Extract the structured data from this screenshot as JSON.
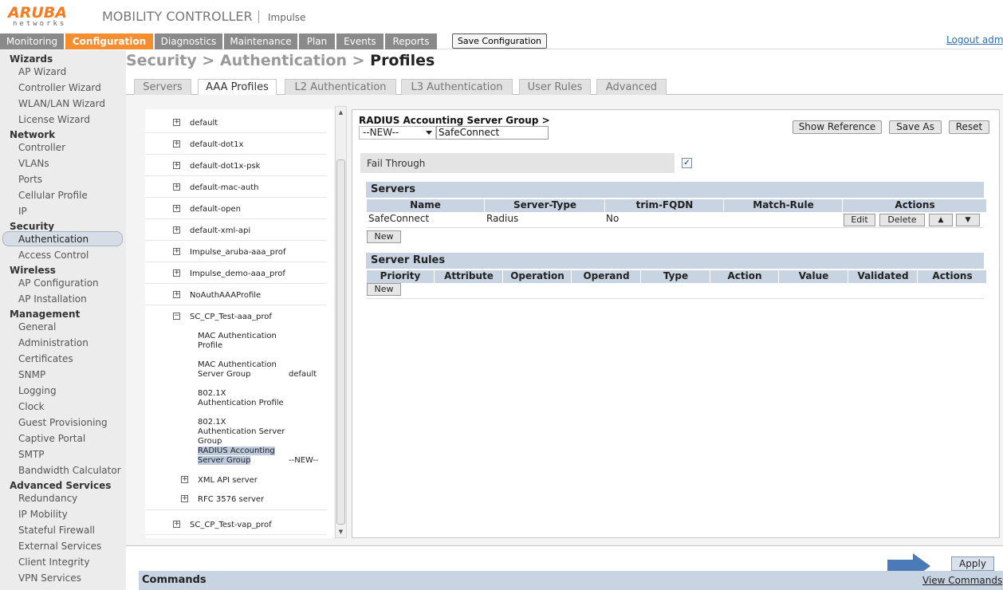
{
  "brand": {
    "logo_main": "ARUBA",
    "logo_sub": "networks",
    "product": "MOBILITY CONTROLLER",
    "controller": "Impulse",
    "accent": "#f68d2e"
  },
  "nav": {
    "tabs": [
      "Monitoring",
      "Configuration",
      "Diagnostics",
      "Maintenance",
      "Plan",
      "Events",
      "Reports"
    ],
    "save_config": "Save Configuration",
    "logout": "Logout admi"
  },
  "sidebar": {
    "wizards": "Wizards",
    "wizard_items": [
      "AP Wizard",
      "Controller Wizard",
      "WLAN/LAN Wizard",
      "License Wizard"
    ],
    "network": "Network",
    "network_items": [
      "Controller",
      "VLANs",
      "Ports",
      "Cellular Profile",
      "IP"
    ],
    "security": "Security",
    "security_items": [
      "Authentication",
      "Access Control"
    ],
    "wireless": "Wireless",
    "wireless_items": [
      "AP Configuration",
      "AP Installation"
    ],
    "management": "Management",
    "management_items": [
      "General",
      "Administration",
      "Certificates",
      "SNMP",
      "Logging",
      "Clock",
      "Guest Provisioning",
      "Captive Portal",
      "SMTP",
      "Bandwidth Calculator"
    ],
    "advanced": "Advanced Services",
    "advanced_items": [
      "Redundancy",
      "IP Mobility",
      "Stateful Firewall",
      "External Services",
      "Client Integrity",
      "VPN Services"
    ]
  },
  "page": {
    "crumb1": "Security",
    "sep": " > ",
    "crumb2": "Authentication",
    "current": "Profiles"
  },
  "subtabs": [
    "Servers",
    "AAA Profiles",
    "L2 Authentication",
    "L3 Authentication",
    "User Rules",
    "Advanced"
  ],
  "tree": {
    "profiles": [
      "default",
      "default-dot1x",
      "default-dot1x-psk",
      "default-mac-auth",
      "default-open",
      "default-xml-api",
      "Impulse_aruba-aaa_prof",
      "Impulse_demo-aaa_prof",
      "NoAuthAAAProfile",
      "SC_CP_Test-aaa_prof"
    ],
    "expanded_children": [
      {
        "label": "MAC Authentication Profile",
        "value": ""
      },
      {
        "label": "MAC Authentication Server Group",
        "value": "default"
      },
      {
        "label": "802.1X Authentication Profile",
        "value": ""
      },
      {
        "label": "802.1X Authentication Server Group",
        "value": ""
      },
      {
        "label": "RADIUS Accounting Server Group",
        "value": "--NEW--"
      }
    ],
    "sub_nodes": [
      "XML API server",
      "RFC 3576 server"
    ],
    "last_profile": "SC_CP_Test-vap_prof",
    "plus": "+",
    "minus": "−"
  },
  "detail": {
    "crumb": "RADIUS Accounting Server Group >",
    "select_value": "--NEW--",
    "name_value": "SafeConnect",
    "show_reference": "Show Reference",
    "save_as": "Save As",
    "reset": "Reset",
    "fail_through": "Fail Through",
    "fail_through_checked": "✓",
    "servers_title": "Servers",
    "servers_headers": [
      "Name",
      "Server-Type",
      "trim-FQDN",
      "Match-Rule",
      "Actions"
    ],
    "server_row": {
      "name": "SafeConnect",
      "type": "Radius",
      "trim": "No",
      "match": ""
    },
    "edit": "Edit",
    "delete": "Delete",
    "up": "▲",
    "down": "▼",
    "new": "New",
    "rules_title": "Server Rules",
    "rules_headers": [
      "Priority",
      "Attribute",
      "Operation",
      "Operand",
      "Type",
      "Action",
      "Value",
      "Validated",
      "Actions"
    ]
  },
  "bottom": {
    "commands": "Commands",
    "apply": "Apply",
    "view_commands": "View Commands"
  }
}
